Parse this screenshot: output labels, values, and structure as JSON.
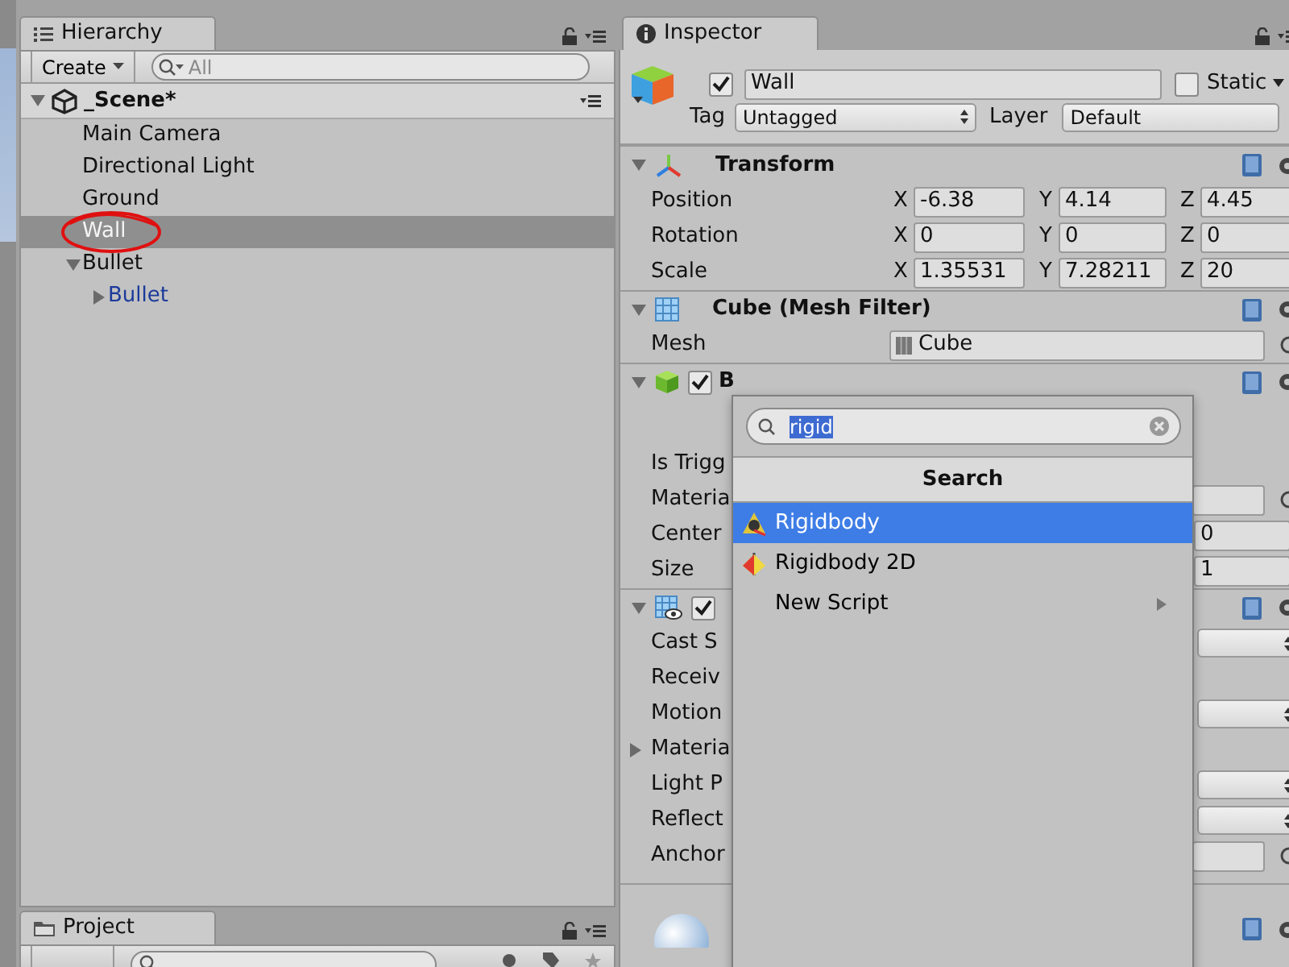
{
  "hierarchy": {
    "tab": "Hierarchy",
    "create": "Create",
    "search_placeholder": "All",
    "scene": {
      "label": "_Scene*",
      "expanded": true
    },
    "items": [
      {
        "label": "Main Camera",
        "selected": false,
        "prefab": false,
        "annotated": false
      },
      {
        "label": "Directional Light",
        "selected": false,
        "prefab": false,
        "annotated": false
      },
      {
        "label": "Ground",
        "selected": false,
        "prefab": false,
        "annotated": false
      },
      {
        "label": "Wall",
        "selected": true,
        "prefab": false,
        "annotated": true
      },
      {
        "label": "Bullet",
        "selected": false,
        "prefab": false,
        "annotated": false,
        "expanded": true,
        "children": [
          {
            "label": "Bullet",
            "selected": false,
            "prefab": true,
            "annotated": false,
            "expanded": false
          }
        ]
      }
    ]
  },
  "project": {
    "tab": "Project"
  },
  "inspector": {
    "tab": "Inspector",
    "object": {
      "active": true,
      "name": "Wall",
      "static": false,
      "static_label": "Static",
      "tag_label": "Tag",
      "tag": "Untagged",
      "layer_label": "Layer",
      "layer": "Default"
    },
    "components": [
      {
        "kind": "transform",
        "title": "Transform",
        "expanded": true,
        "rows": [
          {
            "kind": "vector3",
            "label": "Position",
            "values": [
              {
                "axis": "X",
                "value": "-6.38"
              },
              {
                "axis": "Y",
                "value": "4.14"
              },
              {
                "axis": "Z",
                "value": "4.45"
              }
            ]
          },
          {
            "kind": "vector3",
            "label": "Rotation",
            "values": [
              {
                "axis": "X",
                "value": "0"
              },
              {
                "axis": "Y",
                "value": "0"
              },
              {
                "axis": "Z",
                "value": "0"
              }
            ]
          },
          {
            "kind": "vector3",
            "label": "Scale",
            "values": [
              {
                "axis": "X",
                "value": "1.35531"
              },
              {
                "axis": "Y",
                "value": "7.28211"
              },
              {
                "axis": "Z",
                "value": "20"
              }
            ]
          }
        ]
      },
      {
        "kind": "mesh_filter",
        "title": "Cube (Mesh Filter)",
        "expanded": true,
        "rows": [
          {
            "kind": "object",
            "label": "Mesh",
            "value": "Cube"
          }
        ]
      },
      {
        "kind": "box_collider",
        "title": "B",
        "expanded": true,
        "enabled": true,
        "rows": [
          {
            "kind": "blank"
          },
          {
            "kind": "label",
            "label": "Is Trigg"
          },
          {
            "kind": "object_tail",
            "label": "Materia"
          },
          {
            "kind": "value_tail",
            "label": "Center",
            "value": "0"
          },
          {
            "kind": "value_tail",
            "label": "Size",
            "value": "1"
          }
        ]
      },
      {
        "kind": "mesh_renderer",
        "expanded": true,
        "enabled": true,
        "rows": [
          {
            "kind": "dropdown_tail",
            "label": "Cast S"
          },
          {
            "kind": "label",
            "label": "Receiv"
          },
          {
            "kind": "dropdown_tail",
            "label": "Motion"
          },
          {
            "kind": "foldout",
            "label": "Materia",
            "expanded": false
          },
          {
            "kind": "dropdown_tail",
            "label": "Light P"
          },
          {
            "kind": "dropdown_tail",
            "label": "Reflect"
          },
          {
            "kind": "object_tail",
            "label": "Anchor"
          }
        ]
      }
    ]
  },
  "add_component_popup": {
    "search": "rigid",
    "header": "Search",
    "items": [
      {
        "label": "Rigidbody",
        "selected": true,
        "kind": "rigidbody"
      },
      {
        "label": "Rigidbody 2D",
        "selected": false,
        "kind": "rigidbody2d"
      },
      {
        "label": "New Script",
        "selected": false,
        "kind": "submenu"
      }
    ]
  }
}
